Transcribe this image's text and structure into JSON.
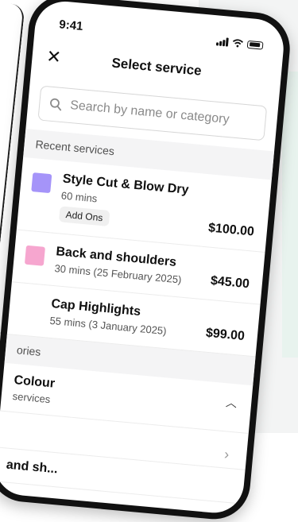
{
  "status": {
    "time": "9:41"
  },
  "header": {
    "title": "Select service"
  },
  "search": {
    "placeholder": "Search by name or category"
  },
  "recent": {
    "heading": "Recent services",
    "items": [
      {
        "name": "Style Cut & Blow Dry",
        "sub": "60 mins",
        "tag": "Add Ons",
        "price": "$100.00",
        "color": "#a594f9"
      },
      {
        "name": "Back and shoulders",
        "sub": "30 mins (25 February 2025)",
        "price": "$45.00",
        "color": "#f6a6cf"
      },
      {
        "name": "Cap Highlights",
        "sub": "55 mins (3 January 2025)",
        "price": "$99.00",
        "color": "#ffffff"
      }
    ]
  },
  "categories": {
    "heading": "ories",
    "items": [
      {
        "name": "Colour",
        "sub": "services"
      },
      {
        "name": "and sh..."
      }
    ]
  },
  "icons": {
    "close": "close-icon",
    "search": "search-icon",
    "chevron_up": "chevron-up-icon",
    "chevron_right": "chevron-right-icon"
  }
}
